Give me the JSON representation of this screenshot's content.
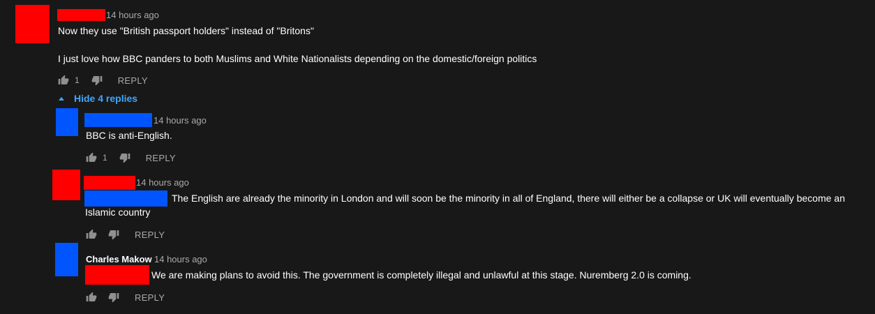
{
  "comments": [
    {
      "time": "14 hours ago",
      "line1": "Now they use \"British passport holders\" instead of \"Britons\"",
      "line2": "I just love how BBC panders to both Muslims and White Nationalists depending on the domestic/foreign politics",
      "likes": "1",
      "reply_label": "REPLY"
    }
  ],
  "hide_replies_label": "Hide 4 replies",
  "replies": [
    {
      "time": "14 hours ago",
      "text": "BBC is anti-English.",
      "likes": "1",
      "reply_label": "REPLY"
    },
    {
      "time": "14 hours ago",
      "text_line1": "The English are already the minority in London and will soon be the minority in all of England, there will either be a collapse or UK will eventually become an",
      "text_line2": "Islamic country",
      "reply_label": "REPLY"
    },
    {
      "author": "Charles Makow",
      "time": "14 hours ago",
      "text": "We are making plans to avoid this. The government is completely illegal and unlawful at this stage. Nuremberg 2.0 is coming.",
      "reply_label": "REPLY"
    }
  ],
  "colors": {
    "redact_red": "#ff0000",
    "redact_blue": "#0055ff",
    "link_blue": "#3ea6ff",
    "background": "#181818"
  }
}
